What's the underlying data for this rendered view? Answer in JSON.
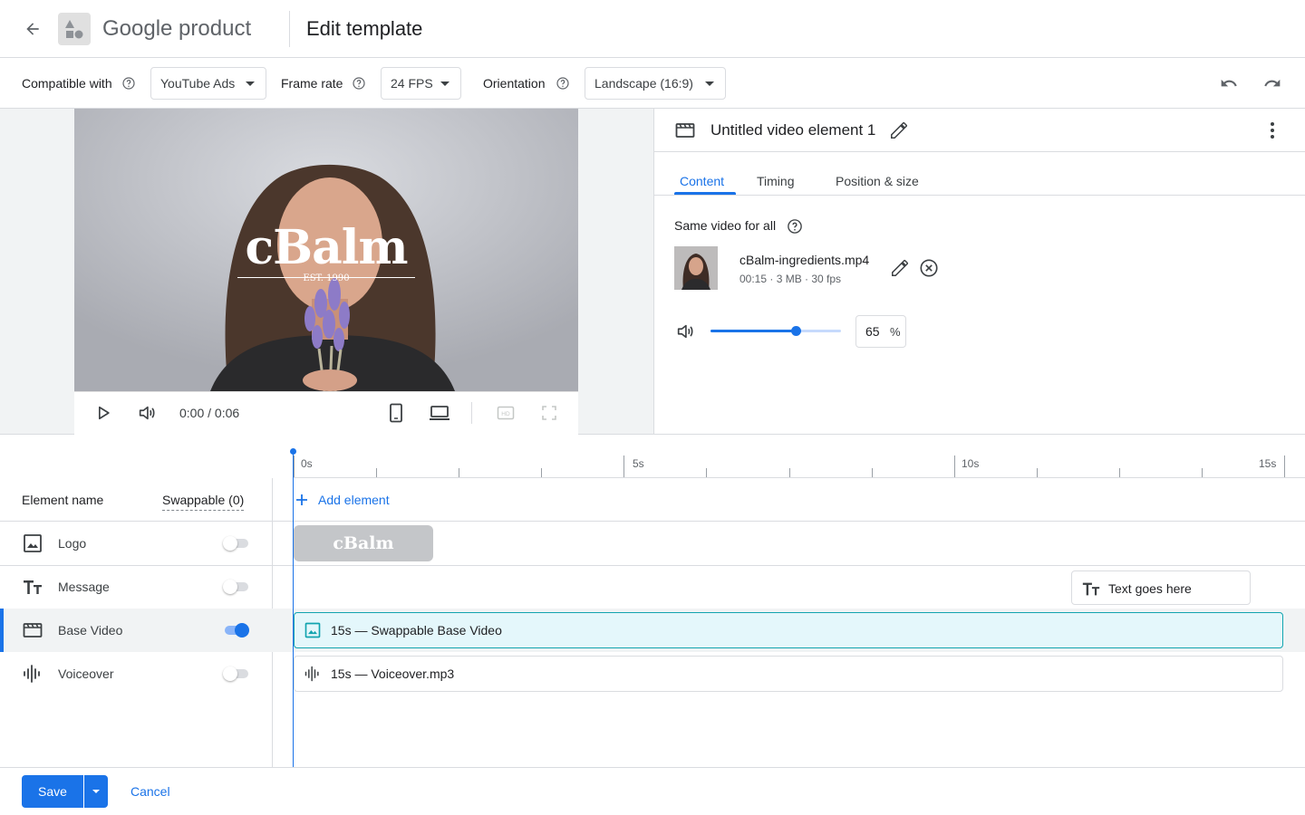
{
  "header": {
    "product_name": "Google product",
    "page_title": "Edit template"
  },
  "toolbar": {
    "compatible_label": "Compatible with",
    "compatible_value": "YouTube Ads",
    "framerate_label": "Frame rate",
    "framerate_value": "24 FPS",
    "orientation_label": "Orientation",
    "orientation_value": "Landscape (16:9)"
  },
  "preview": {
    "brand_text": "cBalm",
    "brand_subtext": "EST. 1990",
    "time_readout": "0:00 / 0:06"
  },
  "panel": {
    "element_title": "Untitled video element 1",
    "tabs": [
      {
        "label": "Content",
        "active": true
      },
      {
        "label": "Timing",
        "active": false
      },
      {
        "label": "Position & size",
        "active": false
      }
    ],
    "same_video_label": "Same video for all",
    "file_name": "cBalm-ingredients.mp4",
    "file_meta": "00:15 · 3 MB · 30 fps",
    "volume_value": "65",
    "volume_fraction": 0.65,
    "volume_unit": "%"
  },
  "timeline": {
    "ticks": [
      "0s",
      "5s",
      "10s",
      "15s"
    ],
    "col_name": "Element name",
    "col_swappable": "Swappable (0)",
    "add_element": "Add element",
    "rows": [
      {
        "label": "Logo",
        "icon": "image-icon",
        "swappable": false
      },
      {
        "label": "Message",
        "icon": "text-icon",
        "swappable": false
      },
      {
        "label": "Base Video",
        "icon": "movie-icon",
        "swappable": true,
        "selected": true
      },
      {
        "label": "Voiceover",
        "icon": "audio-icon",
        "swappable": false
      }
    ],
    "logo_clip_text": "cBalm",
    "message_clip_text": "Text goes here",
    "video_clip_text": "15s — Swappable Base Video",
    "voice_clip_text": "15s — Voiceover.mp3"
  },
  "footer": {
    "save_label": "Save",
    "cancel_label": "Cancel"
  },
  "colors": {
    "accent": "#1a73e8",
    "selected_clip_border": "#12a4af",
    "selected_clip_bg": "#e4f7fb"
  }
}
